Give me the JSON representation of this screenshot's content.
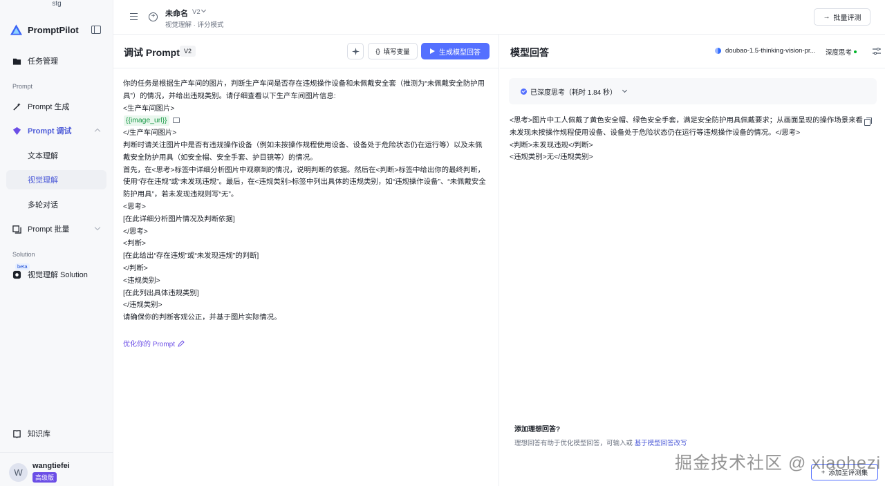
{
  "env_label": "stg",
  "brand": {
    "name": "PromptPilot"
  },
  "sidebar": {
    "task_mgmt": "任务管理",
    "section_prompt": "Prompt",
    "prompt_gen": "Prompt 生成",
    "prompt_debug": "Prompt 调试",
    "debug_sub": [
      "文本理解",
      "视觉理解",
      "多轮对话"
    ],
    "prompt_batch": "Prompt 批量",
    "section_solution": "Solution",
    "solution_badge": "beta",
    "solution_item": "视觉理解 Solution",
    "knowledge": "知识库"
  },
  "user": {
    "initial": "W",
    "name": "wangtiefei",
    "plan": "高级版"
  },
  "header": {
    "title": "未命名",
    "version": "V2",
    "subtitle": "视觉理解 · 评分模式",
    "batch_eval": "批量评测"
  },
  "prompt_panel": {
    "title": "调试 Prompt",
    "version": "V2",
    "fill_vars": "填写变量",
    "generate": "生成模型回答",
    "lines": [
      "你的任务是根据生产车间的图片，判断生产车间是否存在违规操作设备和未佩戴安全套（推测为“未佩戴安全防护用",
      "具”）的情况，并给出违规类别。请仔细查看以下生产车间图片信息:",
      "<生产车间图片>",
      "",
      "</生产车间图片>",
      "判断时请关注图片中是否有违规操作设备（例如未按操作规程使用设备、设备处于危险状态仍在运行等）以及未佩",
      "戴安全防护用具（如安全帽、安全手套、护目镜等）的情况。",
      "首先，在<思考>标签中详细分析图片中观察到的情况，说明判断的依据。然后在<判断>标签中给出你的最终判断，",
      "使用“存在违规”或“未发现违规”。最后，在<违规类别>标签中列出具体的违规类别，如“违规操作设备”、“未佩戴安全",
      "防护用具”，若未发现违规则写“无”。",
      "<思考>",
      "[在此详细分析图片情况及判断依据]",
      "</思考>",
      "<判断>",
      "[在此给出“存在违规”或“未发现违规”的判断]",
      "</判断>",
      "<违规类别>",
      "[在此列出具体违规类别]",
      "</违规类别>",
      "请确保你的判断客观公正，并基于图片实际情况。"
    ],
    "variable": "{{image_url}}",
    "optimize_link": "优化你的 Prompt"
  },
  "answer_panel": {
    "title": "模型回答",
    "model": "doubao-1.5-thinking-vision-pr...",
    "deep_think": "深度思考",
    "think_status": "已深度思考（耗时 1.84 秒）",
    "lines": [
      "<思考>图片中工人佩戴了黄色安全帽、绿色安全手套，满足安全防护用具佩戴要求；从画面呈现的操作场景来看",
      "未发现未按操作规程使用设备、设备处于危险状态仍在运行等违规操作设备的情况。</思考>",
      "<判断>未发现违规</判断>",
      "<违规类别>无</违规类别>"
    ],
    "ideal_title": "添加理想回答?",
    "ideal_desc": "理想回答有助于优化模型回答，可输入或 ",
    "ideal_link": "基于模型回答改写",
    "add_eval": "添加至评测集"
  },
  "watermark": "掘金技术社区 @ xiaohezi",
  "colors": {
    "accent": "#5470ff",
    "brand_purple": "#6b4ee6",
    "var_green": "#1a9a47"
  }
}
